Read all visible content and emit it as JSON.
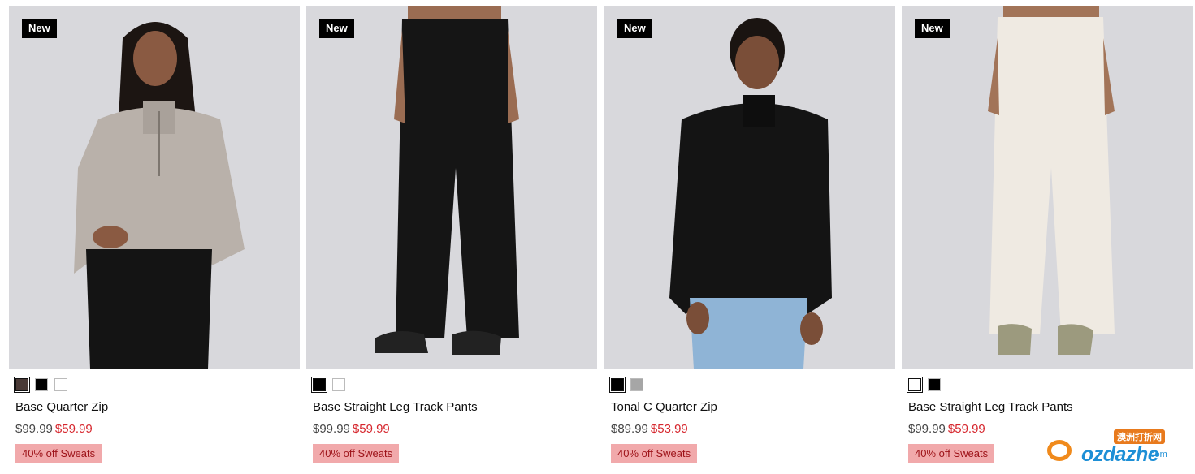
{
  "products": [
    {
      "badge": "New",
      "name": "Base Quarter Zip",
      "original_price": "$99.99",
      "sale_price": "$59.99",
      "promo": "40% off Sweats",
      "swatches": [
        "#4a3a36",
        "#000000",
        "#ffffff"
      ],
      "selected_swatch": 0
    },
    {
      "badge": "New",
      "name": "Base Straight Leg Track Pants",
      "original_price": "$99.99",
      "sale_price": "$59.99",
      "promo": "40% off Sweats",
      "swatches": [
        "#000000",
        "#ffffff"
      ],
      "selected_swatch": 0
    },
    {
      "badge": "New",
      "name": "Tonal C Quarter Zip",
      "original_price": "$89.99",
      "sale_price": "$53.99",
      "promo": "40% off Sweats",
      "swatches": [
        "#000000",
        "#a6a6a6"
      ],
      "selected_swatch": 0
    },
    {
      "badge": "New",
      "name": "Base Straight Leg Track Pants",
      "original_price": "$99.99",
      "sale_price": "$59.99",
      "promo": "40% off Sweats",
      "swatches": [
        "#ffffff",
        "#000000"
      ],
      "selected_swatch": 0
    }
  ],
  "watermark": {
    "brand": "ozdazhe",
    "suffix": ".com",
    "chinese": "澳洲打折网"
  },
  "colors": {
    "sale_price": "#d6262d",
    "promo_bg": "#f1a9ab",
    "promo_text": "#9d1218",
    "badge_bg": "#000000"
  }
}
